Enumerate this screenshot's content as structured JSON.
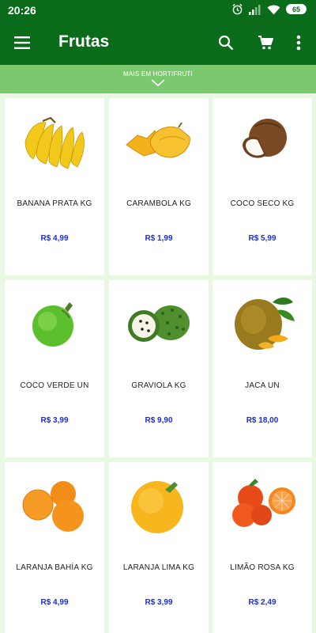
{
  "status_bar": {
    "time": "20:26",
    "battery": "65"
  },
  "app_bar": {
    "title": "Frutas"
  },
  "banner": {
    "label": "MAIS EM HORTIFRUTI"
  },
  "products": [
    {
      "name": "BANANA PRATA KG",
      "price": "R$ 4,99",
      "image": "banana"
    },
    {
      "name": "CARAMBOLA KG",
      "price": "R$ 1,99",
      "image": "starfruit"
    },
    {
      "name": "COCO SECO KG",
      "price": "R$ 5,99",
      "image": "dry-coconut"
    },
    {
      "name": "COCO VERDE UN",
      "price": "R$ 3,99",
      "image": "green-coconut"
    },
    {
      "name": "GRAVIOLA KG",
      "price": "R$ 9,90",
      "image": "soursop"
    },
    {
      "name": "JACA UN",
      "price": "R$ 18,00",
      "image": "jackfruit"
    },
    {
      "name": "LARANJA BAHÍA KG",
      "price": "R$ 4,99",
      "image": "orange"
    },
    {
      "name": "LARANJA LIMA KG",
      "price": "R$ 3,99",
      "image": "lime-orange"
    },
    {
      "name": "LIMÃO ROSA KG",
      "price": "R$ 2,49",
      "image": "rangpur-lime"
    }
  ],
  "colors": {
    "app_bar": "#0a6b1a",
    "banner": "#7bc96f",
    "background": "#e8f8e3",
    "price": "#1a2fd1"
  }
}
